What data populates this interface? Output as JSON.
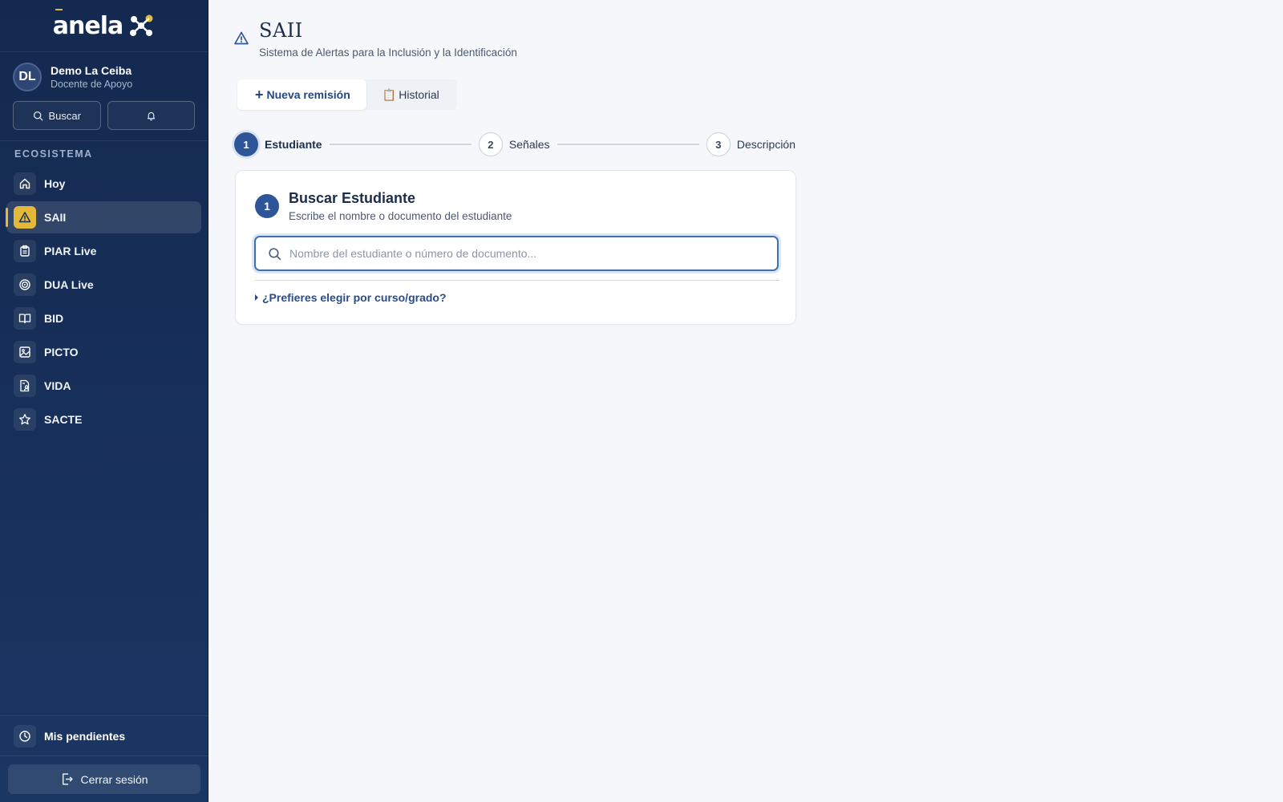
{
  "brand": {
    "name": "anela"
  },
  "user": {
    "initials": "DL",
    "name": "Demo La Ceiba",
    "role": "Docente de Apoyo"
  },
  "quick": {
    "search_label": "Buscar"
  },
  "sidebar": {
    "section_label": "ECOSISTEMA",
    "items": [
      {
        "label": "Hoy",
        "icon": "home-icon"
      },
      {
        "label": "SAII",
        "icon": "alert-triangle-icon",
        "active": true
      },
      {
        "label": "PIAR Live",
        "icon": "clipboard-icon"
      },
      {
        "label": "DUA Live",
        "icon": "target-icon"
      },
      {
        "label": "BID",
        "icon": "book-open-icon"
      },
      {
        "label": "PICTO",
        "icon": "image-icon"
      },
      {
        "label": "VIDA",
        "icon": "file-person-icon"
      },
      {
        "label": "SACTE",
        "icon": "star-icon"
      }
    ],
    "pending_label": "Mis pendientes",
    "logout_label": "Cerrar sesión"
  },
  "header": {
    "title": "SAII",
    "subtitle": "Sistema de Alertas para la Inclusión y la Identificación"
  },
  "tabs": {
    "new_icon": "+",
    "new_label": "Nueva remisión",
    "history_icon": "📋",
    "history_label": "Historial"
  },
  "stepper": [
    {
      "num": "1",
      "label": "Estudiante",
      "active": true
    },
    {
      "num": "2",
      "label": "Señales"
    },
    {
      "num": "3",
      "label": "Descripción"
    }
  ],
  "card": {
    "num": "1",
    "title": "Buscar Estudiante",
    "subtitle": "Escribe el nombre o documento del estudiante",
    "search_value": "",
    "search_placeholder": "Nombre del estudiante o número de documento...",
    "course_link": "¿Prefieres elegir por curso/grado?"
  },
  "colors": {
    "sidebar_bg": "#14294f",
    "accent_gold": "#e4b93a",
    "primary_blue": "#2d5597",
    "link_blue": "#2a4d88"
  }
}
